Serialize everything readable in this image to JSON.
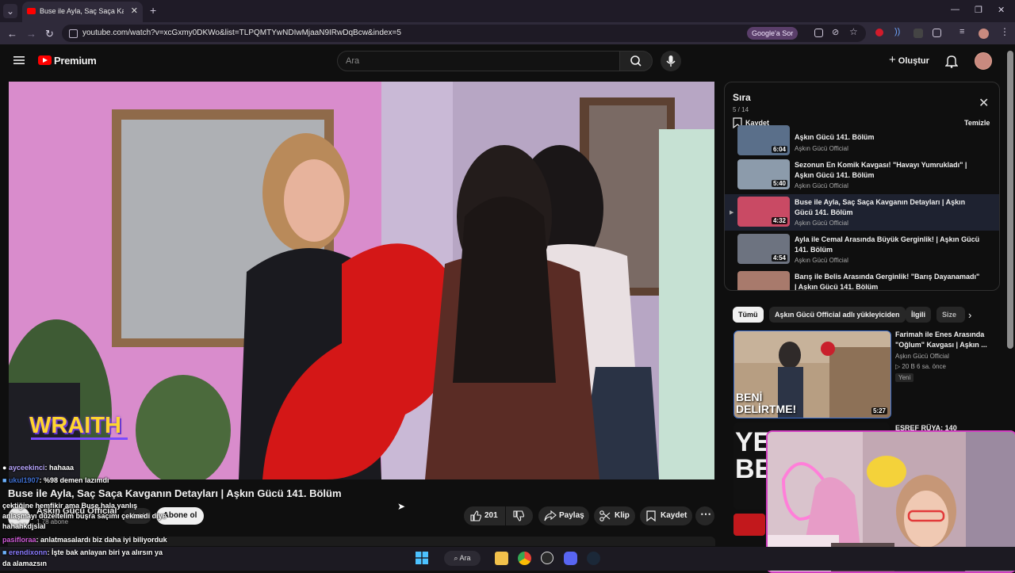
{
  "browser": {
    "tab_title": "Buse ile Ayla, Saç Saça Kavg",
    "url": "youtube.com/watch?v=xcGxmy0DKWo&list=TLPQMTYwNDIwMjaaN9IRwDqBcw&index=5",
    "google_sor_label": "Google'a Sor"
  },
  "youtube": {
    "logo_text": "Premium",
    "search_placeholder": "Ara",
    "create_label": "Oluştur"
  },
  "video": {
    "overlay_brand": "WRAITH",
    "title": "Buse ile Ayla, Saç Saça Kavganın Detayları | Aşkın Gücü 141. Bölüm",
    "channel_name": "Aşkın Gücü Official",
    "subscribers": "1,78 abone",
    "join_label": "Katıl",
    "subscribe_label": "Abone ol",
    "like_count": "201",
    "share_label": "Paylaş",
    "clip_label": "Klip",
    "save_label": "Kaydet"
  },
  "queue": {
    "title": "Sıra",
    "position": "5 / 14",
    "save_label": "Kaydet",
    "clear_label": "Temizle",
    "items": [
      {
        "title": "Aşkın Gücü 141. Bölüm",
        "channel": "Aşkın Gücü Official",
        "duration": "6:04"
      },
      {
        "title": "Sezonun En Komik Kavgası! \"Havayı Yumrukladı\" | Aşkın Gücü 141. Bölüm",
        "channel": "Aşkın Gücü Official",
        "duration": "5:40"
      },
      {
        "title": "Buse ile Ayla, Saç Saça Kavganın Detayları | Aşkın Gücü 141. Bölüm",
        "channel": "Aşkın Gücü Official",
        "duration": "4:32"
      },
      {
        "title": "Ayla ile Cemal Arasında Büyük Gerginlik! | Aşkın Gücü 141. Bölüm",
        "channel": "Aşkın Gücü Official",
        "duration": "4:54"
      },
      {
        "title": "Barış ile Belis Arasında Gerginlik! \"Barış Dayanamadı\" | Aşkın Gücü 141. Bölüm",
        "channel": "",
        "duration": ""
      }
    ]
  },
  "chips": [
    "Tümü",
    "Aşkın Gücü Official adlı yükleyiciden",
    "İlgili",
    "Size"
  ],
  "recommendations": [
    {
      "title": "Farimah ile Enes Arasında \"Oğlum\" Kavgası | Aşkın ...",
      "channel": "Aşkın Gücü Official",
      "meta": "20 B  6 sa. önce",
      "badge": "Yeni",
      "duration": "5:27",
      "thumb_caption_1": "BENİ",
      "thumb_caption_2": "DELİRTME!"
    },
    {
      "title": "EŞREF RÜYA: 140",
      "thumb_caption_1": "YET",
      "thumb_caption_2": "BE!"
    }
  ],
  "chat": [
    {
      "user": "ayceekinci",
      "msg": ": hahaaa"
    },
    {
      "user": "ukul1907",
      "msg": ": %98 demen lazımdı"
    },
    {
      "user": "",
      "msg": "çektiğine hemfikir ama Buse hala yanlış"
    },
    {
      "user": "",
      "msg": "anlaşmayı düzeltelim buşra saçımı çekmedi diye"
    },
    {
      "user": "",
      "msg": "hahahkdjslal"
    },
    {
      "user": "pasifloraa",
      "msg": ": anlatmasalardı biz daha iyi biliyorduk"
    },
    {
      "user": "erendixonn",
      "msg": ": İşte bak anlayan biri ya alırsın ya"
    },
    {
      "user": "",
      "msg": "da alamazsın"
    }
  ],
  "taskbar": {
    "search_label": "Ara"
  },
  "colors": {
    "youtube_red": "#ff0000",
    "webcam_border": "#d13fc1",
    "chip_selected": "#f1f1f1"
  }
}
